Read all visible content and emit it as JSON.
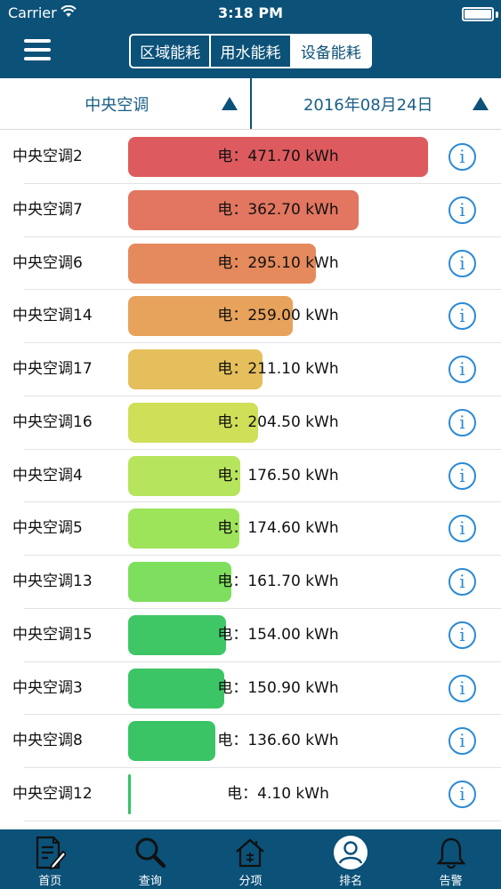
{
  "status_bar": {
    "carrier": "Carrier",
    "time": "3:18 PM"
  },
  "header": {
    "menu_icon": "hamburger-menu-icon",
    "segments": [
      {
        "label": "区域能耗",
        "active": false
      },
      {
        "label": "用水能耗",
        "active": false
      },
      {
        "label": "设备能耗",
        "active": true
      }
    ]
  },
  "filters": {
    "device": {
      "label": "中央空调",
      "icon": "triangle-up-icon"
    },
    "date": {
      "label": "2016年08月24日",
      "icon": "triangle-up-icon"
    }
  },
  "ranking": {
    "max_value": 471.7,
    "rows": [
      {
        "name": "中央空调2",
        "value": "电：471.70 kWh",
        "kwh": 471.7,
        "color": "#dd5b5e"
      },
      {
        "name": "中央空调7",
        "value": "电：362.70 kWh",
        "kwh": 362.7,
        "color": "#e27660"
      },
      {
        "name": "中央空调6",
        "value": "电：295.10 kWh",
        "kwh": 295.1,
        "color": "#e58a5c"
      },
      {
        "name": "中央空调14",
        "value": "电：259.00 kWh",
        "kwh": 259.0,
        "color": "#e7a25c"
      },
      {
        "name": "中央空调17",
        "value": "电：211.10 kWh",
        "kwh": 211.1,
        "color": "#e5bf5b"
      },
      {
        "name": "中央空调16",
        "value": "电：204.50 kWh",
        "kwh": 204.5,
        "color": "#cfdf58"
      },
      {
        "name": "中央空调4",
        "value": "电：176.50 kWh",
        "kwh": 176.5,
        "color": "#b6e45c"
      },
      {
        "name": "中央空调5",
        "value": "电：174.60 kWh",
        "kwh": 174.6,
        "color": "#9ee45a"
      },
      {
        "name": "中央空调13",
        "value": "电：161.70 kWh",
        "kwh": 161.7,
        "color": "#7ddf5d"
      },
      {
        "name": "中央空调15",
        "value": "电：154.00 kWh",
        "kwh": 154.0,
        "color": "#3fc766"
      },
      {
        "name": "中央空调3",
        "value": "电：150.90 kWh",
        "kwh": 150.9,
        "color": "#3cc566"
      },
      {
        "name": "中央空调8",
        "value": "电：136.60 kWh",
        "kwh": 136.6,
        "color": "#3ac466"
      },
      {
        "name": "中央空调12",
        "value": "电：4.10 kWh",
        "kwh": 4.1,
        "color": "#36c165"
      }
    ]
  },
  "tabbar": {
    "tabs": [
      {
        "label": "首页",
        "icon": "document-edit-icon",
        "active": false
      },
      {
        "label": "查询",
        "icon": "search-icon",
        "active": false
      },
      {
        "label": "分项",
        "icon": "house-icon",
        "active": false
      },
      {
        "label": "排名",
        "icon": "user-icon",
        "active": true
      },
      {
        "label": "告警",
        "icon": "bell-icon",
        "active": false
      }
    ]
  },
  "colors": {
    "primary": "#0b5178",
    "info": "#2a8ad6",
    "text_accent": "#1a5f86"
  }
}
